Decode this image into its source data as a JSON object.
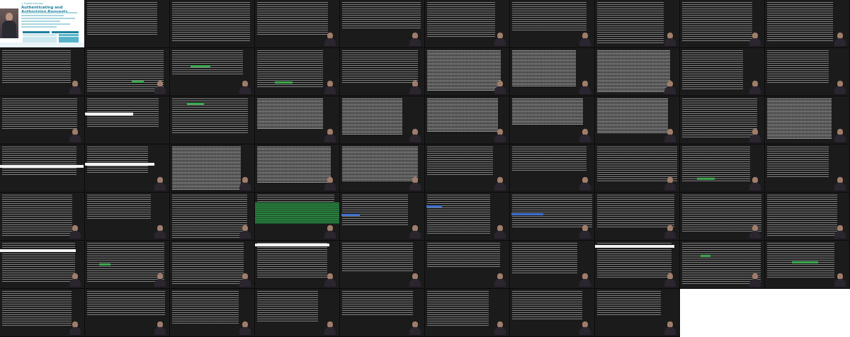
{
  "slide": {
    "course": "> Guided Exercises",
    "title": "Authenticating and Authorizing Requests"
  },
  "grid": {
    "columns": 10,
    "rows": 7,
    "filled_cells": 68
  },
  "terminal_snippets": [
    "$ curl -v -H \"Authorization: Bearer ...\"",
    "HTTP/1.1 401 Unauthorized",
    "HTTP/1.1 200 OK",
    "x-envoy-upstream-service-time: 4",
    "Forbidden"
  ],
  "colors": {
    "terminal_bg": "#1b1b1b",
    "terminal_text": "#cfcfcf",
    "highlight_green": "#3aa94e",
    "highlight_blue": "#3d6fd0",
    "slide_accent": "#1f7f9d"
  }
}
